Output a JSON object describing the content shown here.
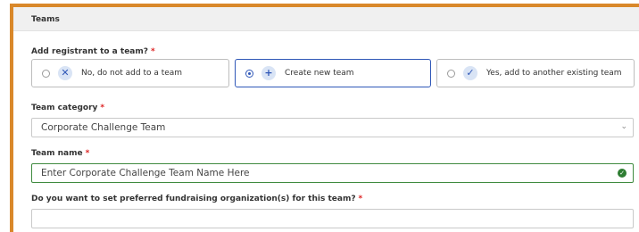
{
  "section": {
    "title": "Teams"
  },
  "add_registrant": {
    "label": "Add registrant to a team?",
    "required_mark": "*",
    "options": [
      {
        "label": "No, do not add to a team",
        "icon": "close-icon",
        "selected": false
      },
      {
        "label": "Create new team",
        "icon": "plus-icon",
        "selected": true
      },
      {
        "label": "Yes, add to another existing team",
        "icon": "check-icon",
        "selected": false
      }
    ]
  },
  "team_category": {
    "label": "Team category",
    "required_mark": "*",
    "value": "Corporate Challenge Team"
  },
  "team_name": {
    "label": "Team name",
    "required_mark": "*",
    "value": "Enter Corporate Challenge Team Name Here"
  },
  "fundraising": {
    "label": "Do you want to set preferred fundraising organization(s) for this team?",
    "required_mark": "*",
    "value": ""
  },
  "colors": {
    "accent": "#2f57b7",
    "frame": "#d9882a",
    "valid": "#3f8b3f",
    "required": "#d22222"
  }
}
